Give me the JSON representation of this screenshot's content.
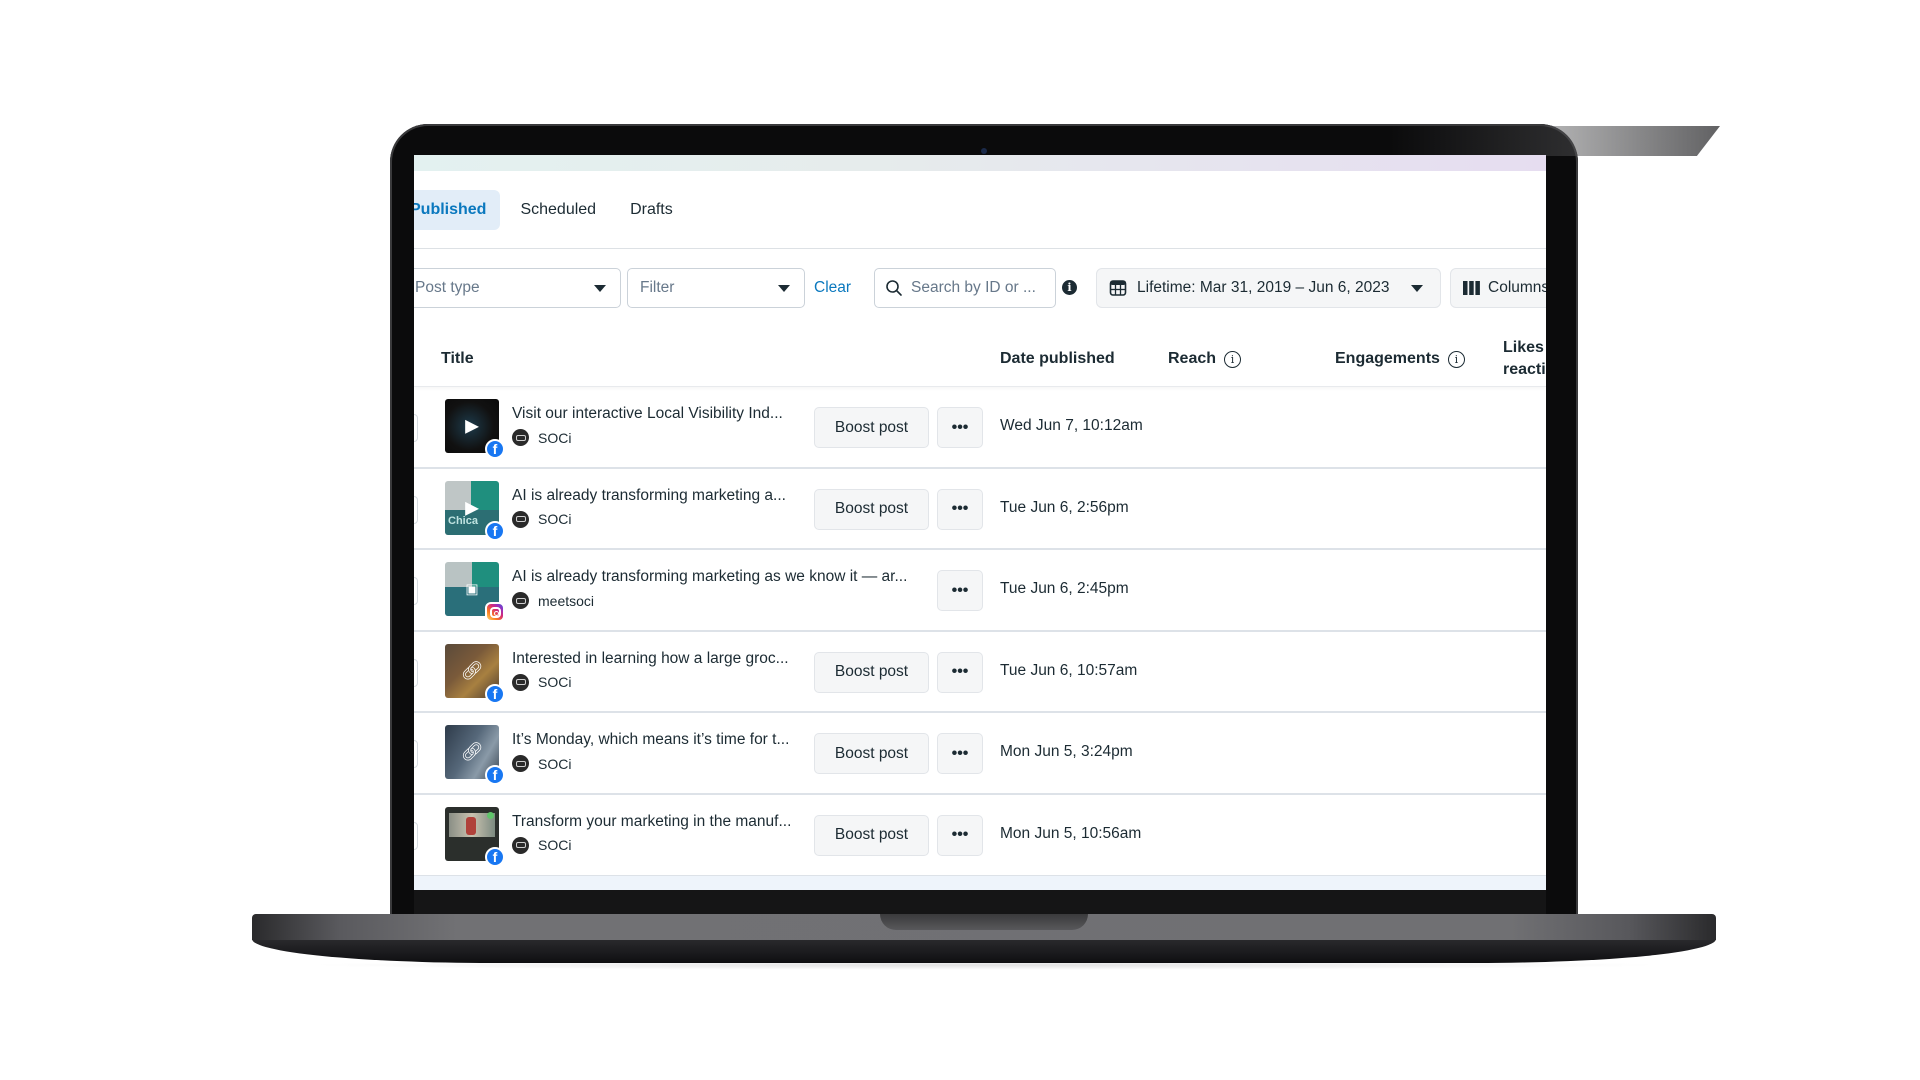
{
  "tabs": [
    {
      "label": "Published",
      "active": true
    },
    {
      "label": "Scheduled",
      "active": false
    },
    {
      "label": "Drafts",
      "active": false
    }
  ],
  "toolbar": {
    "post_type_label": "Post type",
    "filter_label": "Filter",
    "clear_label": "Clear",
    "search_placeholder": "Search by ID or ...",
    "info_icon": "i",
    "date_range_label": "Lifetime: Mar 31, 2019 – Jun 6, 2023",
    "columns_label": "Columns"
  },
  "table": {
    "headers": {
      "title": "Title",
      "date_published": "Date published",
      "reach": "Reach",
      "engagements": "Engagements",
      "likes_line1": "Likes",
      "likes_line2": "reactions"
    },
    "boost_label": "Boost post",
    "more_label": "•••",
    "rows": [
      {
        "title": "Visit our interactive Local Visibility Ind...",
        "account": "SOCi",
        "network": "facebook",
        "thumb_type": "video",
        "has_boost": true,
        "date": "Wed Jun 7, 10:12am"
      },
      {
        "title": "AI is already transforming marketing a...",
        "account": "SOCi",
        "network": "facebook",
        "thumb_type": "video",
        "has_boost": true,
        "date": "Tue Jun 6, 2:56pm"
      },
      {
        "title": "AI is already transforming marketing as we know it — ar...",
        "account": "meetsoci",
        "network": "instagram",
        "thumb_type": "reel",
        "has_boost": false,
        "date": "Tue Jun 6, 2:45pm"
      },
      {
        "title": "Interested in learning how a large groc...",
        "account": "SOCi",
        "network": "facebook",
        "thumb_type": "link",
        "has_boost": true,
        "date": "Tue Jun 6, 10:57am"
      },
      {
        "title": "It’s Monday, which means it’s time for t...",
        "account": "SOCi",
        "network": "facebook",
        "thumb_type": "link",
        "has_boost": true,
        "date": "Mon Jun 5, 3:24pm"
      },
      {
        "title": "Transform your marketing in the manuf...",
        "account": "SOCi",
        "network": "facebook",
        "thumb_type": "image",
        "has_boost": true,
        "date": "Mon Jun 5, 10:56am"
      }
    ]
  },
  "colors": {
    "accent": "#0a78be",
    "active_tab_bg": "#e2edf8",
    "facebook": "#1877f2",
    "text": "#1c2b33"
  }
}
